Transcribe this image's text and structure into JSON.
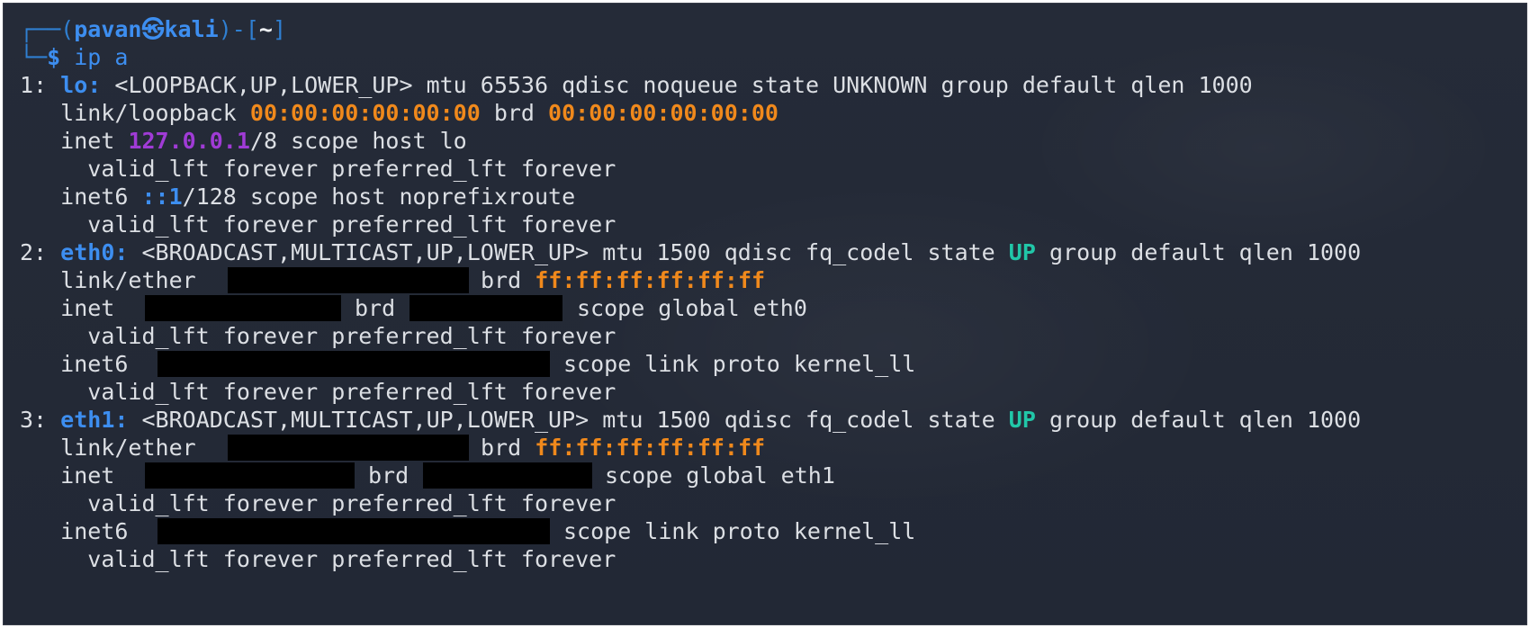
{
  "prompt": {
    "open": "┌──(",
    "user": "pavan",
    "at": "㉿",
    "host": "kali",
    "mid": ")-[",
    "dir": "~",
    "close": "]",
    "corner": "└─",
    "symbol": "$",
    "command": "ip a"
  },
  "lo": {
    "index": "1:",
    "name": "lo:",
    "flags": "<LOOPBACK,UP,LOWER_UP> mtu 65536 qdisc noqueue state UNKNOWN group default qlen 1000",
    "link_label": "link/loopback",
    "mac": "00:00:00:00:00:00",
    "brd_label": "brd",
    "brd_mac": "00:00:00:00:00:00",
    "inet_label": "inet",
    "inet_addr": "127.0.0.1",
    "inet_suffix": "/8 scope host lo",
    "valid1": "valid_lft forever preferred_lft forever",
    "inet6_label": "inet6",
    "inet6_addr": "::1",
    "inet6_suffix": "/128 scope host noprefixroute",
    "valid2": "valid_lft forever preferred_lft forever"
  },
  "eth0": {
    "index": "2:",
    "name": "eth0:",
    "flags_pre": "<BROADCAST,MULTICAST,UP,LOWER_UP> mtu 1500 qdisc fq_codel state",
    "state": "UP",
    "flags_post": "group default qlen 1000",
    "link_label": "link/ether",
    "brd_label": "brd",
    "brd_mac": "ff:ff:ff:ff:ff:ff",
    "inet_label": "inet",
    "inet_brd": "brd",
    "inet_scope": "scope global eth0",
    "valid1": "valid_lft forever preferred_lft forever",
    "inet6_label": "inet6",
    "inet6_scope": "scope link proto kernel_ll",
    "valid2": "valid_lft forever preferred_lft forever"
  },
  "eth1": {
    "index": "3:",
    "name": "eth1:",
    "flags_pre": "<BROADCAST,MULTICAST,UP,LOWER_UP> mtu 1500 qdisc fq_codel state",
    "state": "UP",
    "flags_post": "group default qlen 1000",
    "link_label": "link/ether",
    "brd_label": "brd",
    "brd_mac": "ff:ff:ff:ff:ff:ff",
    "inet_label": "inet",
    "inet_brd": "brd",
    "inet_scope": "scope global eth1",
    "valid1": "valid_lft forever preferred_lft forever",
    "inet6_label": "inet6",
    "inet6_scope": "scope link proto kernel_ll",
    "valid2": "valid_lft forever preferred_lft forever"
  },
  "colors": {
    "background": "#242a37",
    "text": "#dcdfe4",
    "prompt": "#3d8ef0",
    "mac": "#f0891c",
    "ipv4": "#a03bd6",
    "state_up": "#21c7a8",
    "redaction": "#000000"
  }
}
